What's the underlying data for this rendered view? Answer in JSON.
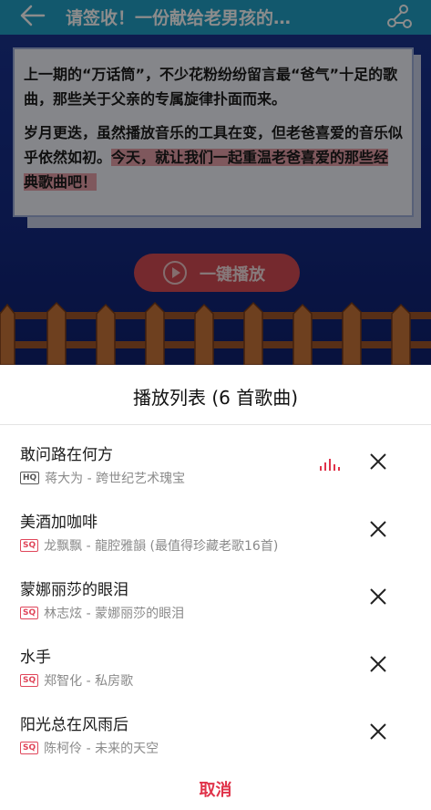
{
  "header": {
    "title": "请签收！一份献给老男孩的…"
  },
  "article": {
    "para1": "上一期的“万话筒”，不少花粉纷纷留言最“爸气”十足的歌曲，那些关于父亲的专属旋律扑面而来。",
    "para2_plain": "岁月更迭，虽然播放音乐的工具在变，但老爸喜爱的音乐似乎依然如初。",
    "para2_highlight": "今天，就让我们一起重温老爸喜爱的那些经典歌曲吧！",
    "play_all_label": "一键播放"
  },
  "playlist": {
    "title": "播放列表 (6 首歌曲)",
    "songs": [
      {
        "title": "敢问路在何方",
        "quality": "HQ",
        "meta": "蒋大为 - 跨世纪艺术瑰宝",
        "playing": true
      },
      {
        "title": "美酒加咖啡",
        "quality": "SQ",
        "meta": "龙飘飘 - 龍腔雅韻 (最值得珍藏老歌16首)",
        "playing": false
      },
      {
        "title": "蒙娜丽莎的眼泪",
        "quality": "SQ",
        "meta": "林志炫 - 蒙娜丽莎的眼泪",
        "playing": false
      },
      {
        "title": "水手",
        "quality": "SQ",
        "meta": "郑智化 - 私房歌",
        "playing": false
      },
      {
        "title": "阳光总在风雨后",
        "quality": "SQ",
        "meta": "陈柯伶 - 未来的天空",
        "playing": false
      }
    ],
    "cancel_label": "取消"
  },
  "icons": {
    "back": "arrow-left-icon",
    "share": "share-icon",
    "remove": "close-icon",
    "now_playing": "equalizer-icon",
    "play": "play-icon"
  },
  "colors": {
    "accent": "#e0334a",
    "topbar": "#22a0c6",
    "background": "#142a84"
  }
}
